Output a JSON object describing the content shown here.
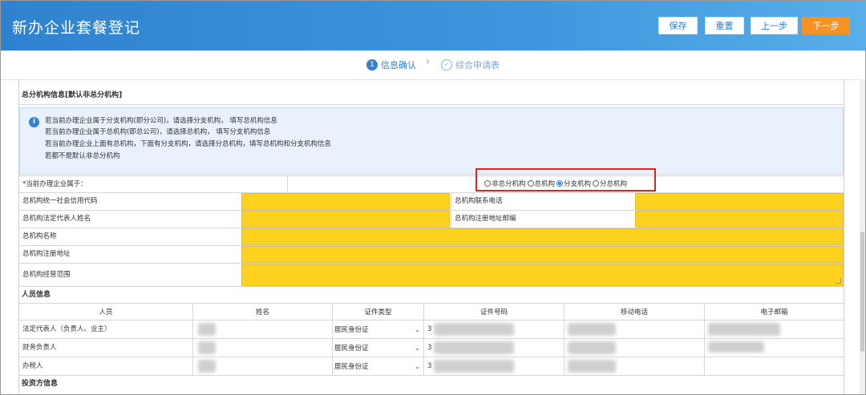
{
  "header": {
    "title": "新办企业套餐登记",
    "buttons": {
      "save": "保存",
      "reset": "重置",
      "prev": "上一步",
      "next": "下一步"
    }
  },
  "steps": {
    "step1": {
      "num": "1",
      "label": "信息确认"
    },
    "arrow": "›",
    "step2": {
      "label": "综合申请表"
    }
  },
  "section_branch": {
    "title": "总分机构信息[默认非总分机构]",
    "info_icon": "i",
    "info_lines": [
      "若当前办理企业属于分支机构(即分公司)，请选择分支机构，  填写总机构信息",
      "若当前办理企业属于总机构(即总公司)，请选择总机构，  填写分支机构信息",
      "若当前办理企业上面有总机构，下面有分支机构，请选择分总机构，填写总机构和分支机构信息",
      "若都不是默认非总分机构"
    ],
    "belong_label": "*当前办理企业属于：",
    "radio_options": [
      "非总分机构",
      "总机构",
      "分支机构",
      "分总机构"
    ],
    "radio_selected": "分支机构",
    "fields": {
      "credit_code": "总机构统一社会信用代码",
      "phone": "总机构联系电话",
      "legal_name": "总机构法定代表人姓名",
      "postcode": "总机构注册地址邮编",
      "name": "总机构名称",
      "address": "总机构注册地址",
      "scope": "总机构经营范围"
    }
  },
  "section_people": {
    "title": "人员信息",
    "headers": [
      "人员",
      "姓名",
      "证件类型",
      "证件号码",
      "移动电话",
      "电子邮箱"
    ],
    "rows": [
      {
        "role": "法定代表人（负责人、业主）",
        "id_type": "居民身份证",
        "id_prefix": "3"
      },
      {
        "role": "财务负责人",
        "id_type": "居民身份证",
        "id_prefix": "3"
      },
      {
        "role": "办税人",
        "id_type": "居民身份证",
        "id_prefix": "3"
      }
    ],
    "dropdown_icon": "chevron-down-icon"
  },
  "section_investor": {
    "title": "投资方信息"
  },
  "colors": {
    "accent": "#2f82cf",
    "orange": "#f7931e",
    "required_yellow": "#ffd21f",
    "highlight": "#d9251c"
  }
}
